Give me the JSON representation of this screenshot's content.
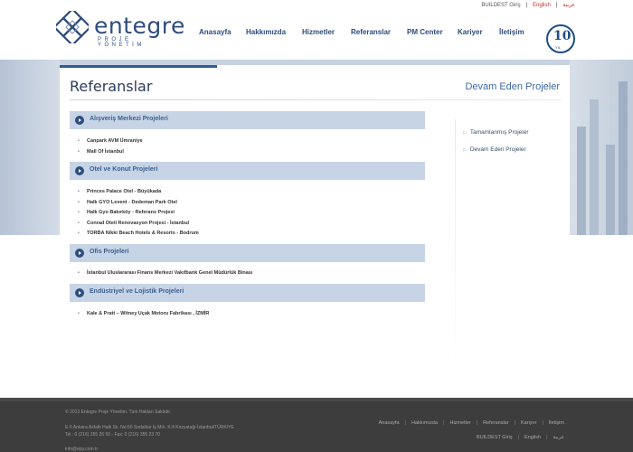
{
  "logo": {
    "name": "entegre",
    "tagline": "PROJE YÖNETİM"
  },
  "top_links": {
    "buildest": "BUILDEST Giriş",
    "english": "English",
    "arabic": "عربية"
  },
  "nav": [
    "Anasayfa",
    "Hakkımızda",
    "Hizmetler",
    "Referanslar",
    "PM Center",
    "Kariyer",
    "İletişim"
  ],
  "badge": {
    "number": "10",
    "label": "YIL"
  },
  "page": {
    "title": "Referanslar",
    "subtitle": "Devam Eden Projeler"
  },
  "sections": [
    {
      "title": "Alışveriş Merkezi Projeleri",
      "items": [
        "Canpark AVM Ümraniye",
        "Mall Of İstanbul"
      ]
    },
    {
      "title": "Otel ve Konut Projeleri",
      "items": [
        "Princes Palace Otel - Büyükada",
        "Halk GYO Levent - Dedeman Park Otel",
        "Halk Gyo Bakırköy - Referans Projesi",
        "Conrad Oteli Renovasyon Projesi - İstanbul",
        "TORBA Nikki Beach Hotels & Resorts - Bodrum"
      ]
    },
    {
      "title": "Ofis Projeleri",
      "items": [
        "İstanbul Uluslararası Finans Merkezi Vakıfbank Genel Müdürlük Binası"
      ]
    },
    {
      "title": "Endüstriyel ve Lojistik Projeleri",
      "items": [
        "Kale & Pratt – Witney Uçak Motoru Fabrikası , İZMİR"
      ]
    }
  ],
  "sidebar": [
    "Tamamlanmış Projeler",
    "Devam Eden Projeler"
  ],
  "footer": {
    "copyright": "© 2013 Entegre Proje Yönetim. Tüm Hakları Saklıdır.",
    "address": "E-5 Ankara Asfaltı Halk Sk. No:56 Sodalkar İş Mrk. K:4 Kozyatağı-İstanbul/TÜRKİYE",
    "tel": "Tel : 0 (216) 355 26 50 - Fax: 0 (216) 355 23 70",
    "email": "info@epy.com.tr",
    "nav": [
      "Anasayfa",
      "Hakkımızda",
      "Hizmetler",
      "Referanslar",
      "Kariyer",
      "İletişim"
    ],
    "lang": {
      "buildest": "BUILDEST Giriş",
      "english": "English",
      "arabic": "عربية"
    }
  },
  "colors": {
    "primary": "#2c4a7f",
    "section_bg": "#c6d4e6",
    "accent_red": "#c0282d",
    "footer_bg": "#3d3d3d"
  }
}
